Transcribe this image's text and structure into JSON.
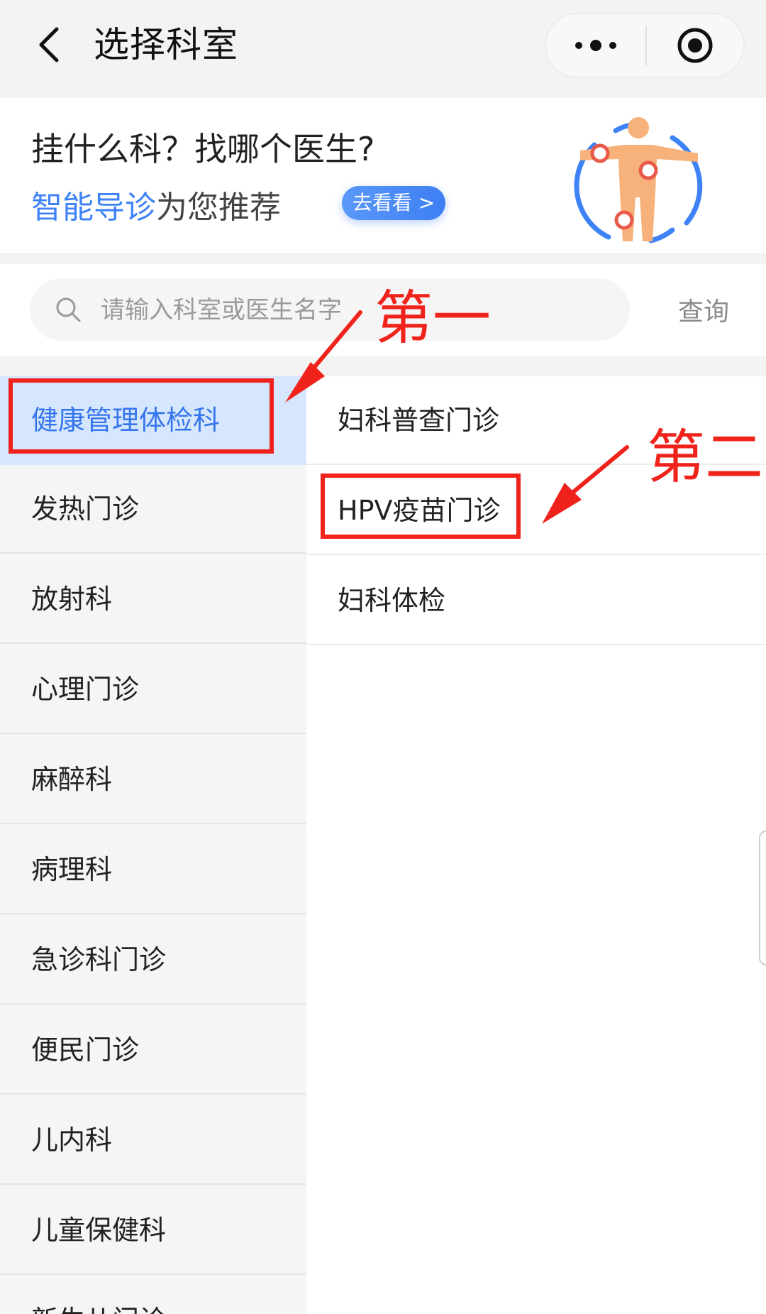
{
  "nav": {
    "title": "选择科室",
    "back_icon": "chevron-left-icon",
    "more_icon": "more-dots-icon",
    "close_icon": "target-circle-icon"
  },
  "banner": {
    "heading": "挂什么科？找哪个医生?",
    "sub_highlight": "智能导诊",
    "sub_text": "为您推荐",
    "button_label": "去看看 >",
    "accent_color": "#3e82f7"
  },
  "search": {
    "placeholder": "请输入科室或医生名字",
    "value": "",
    "query_label": "查询"
  },
  "departments": [
    {
      "label": "健康管理体检科",
      "selected": true
    },
    {
      "label": "发热门诊"
    },
    {
      "label": "放射科"
    },
    {
      "label": "心理门诊"
    },
    {
      "label": "麻醉科"
    },
    {
      "label": "病理科"
    },
    {
      "label": "急诊科门诊"
    },
    {
      "label": "便民门诊"
    },
    {
      "label": "儿内科"
    },
    {
      "label": "儿童保健科"
    },
    {
      "label": "新生儿门诊"
    }
  ],
  "sub_departments": [
    {
      "label": "妇科普查门诊"
    },
    {
      "label": "HPV疫苗门诊"
    },
    {
      "label": "妇科体检"
    }
  ],
  "annotations": {
    "first_label": "第一",
    "second_label": "第二",
    "color": "#f0231c"
  }
}
